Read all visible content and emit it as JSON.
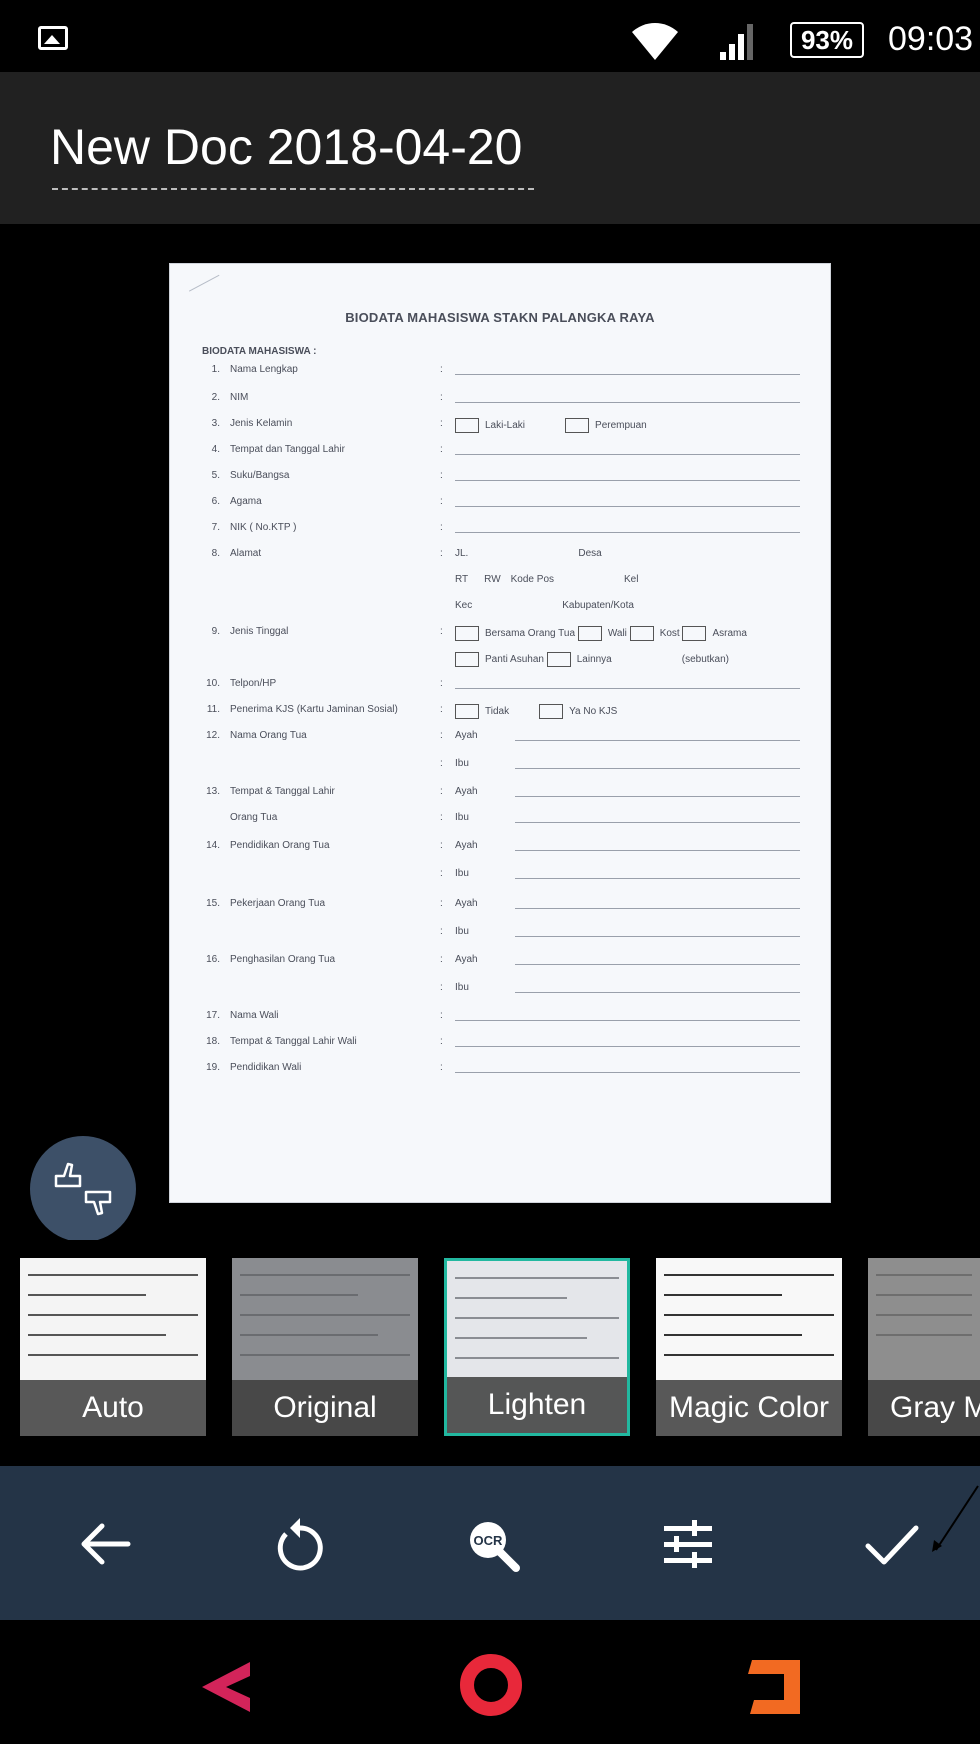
{
  "status_bar": {
    "battery": "93%",
    "time": "09:03",
    "icons": [
      "gallery-icon",
      "wifi-icon",
      "signal-icon",
      "battery-icon"
    ]
  },
  "header": {
    "title": "New Doc 2018-04-20"
  },
  "document": {
    "title": "BIODATA MAHASISWA STAKN PALANGKA RAYA",
    "section": "BIODATA MAHASISWA :",
    "fields": [
      {
        "num": "1.",
        "label": "Nama Lengkap"
      },
      {
        "num": "2.",
        "label": "NIM"
      },
      {
        "num": "3.",
        "label": "Jenis Kelamin"
      },
      {
        "num": "4.",
        "label": "Tempat dan Tanggal Lahir"
      },
      {
        "num": "5.",
        "label": "Suku/Bangsa"
      },
      {
        "num": "6.",
        "label": "Agama"
      },
      {
        "num": "7.",
        "label": "NIK ( No.KTP )"
      },
      {
        "num": "8.",
        "label": "Alamat"
      },
      {
        "num": "9.",
        "label": "Jenis Tinggal"
      },
      {
        "num": "10.",
        "label": "Telpon/HP"
      },
      {
        "num": "11.",
        "label": "Penerima KJS (Kartu Jaminan Sosial)"
      },
      {
        "num": "12.",
        "label": "Nama Orang Tua"
      },
      {
        "num": "13.",
        "label": "Tempat & Tanggal Lahir"
      },
      {
        "num": "",
        "label": "Orang Tua"
      },
      {
        "num": "14.",
        "label": "Pendidikan Orang Tua"
      },
      {
        "num": "15.",
        "label": "Pekerjaan Orang Tua"
      },
      {
        "num": "16.",
        "label": "Penghasilan Orang Tua"
      },
      {
        "num": "17.",
        "label": "Nama Wali"
      },
      {
        "num": "18.",
        "label": "Tempat & Tanggal Lahir Wali"
      },
      {
        "num": "19.",
        "label": "Pendidikan Wali"
      }
    ],
    "gender_options": [
      "Laki-Laki",
      "Perempuan"
    ],
    "address_parts": {
      "line1": "JL.",
      "desa": "Desa",
      "rt": "RT",
      "rw": "RW",
      "kodepos": "Kode Pos",
      "kel": "Kel",
      "kec": "Kec",
      "kab": "Kabupaten/Kota"
    },
    "residence_options": [
      "Bersama Orang Tua",
      "Wali",
      "Kost",
      "Asrama",
      "Panti Asuhan",
      "Lainnya",
      "(sebutkan)"
    ],
    "kjs_options": [
      "Tidak",
      "Ya",
      "No KJS"
    ],
    "parent_labels": {
      "father": "Ayah",
      "mother": "Ibu"
    }
  },
  "filters": [
    {
      "label": "Auto",
      "selected": false
    },
    {
      "label": "Original",
      "selected": false
    },
    {
      "label": "Lighten",
      "selected": true
    },
    {
      "label": "Magic Color",
      "selected": false
    },
    {
      "label": "Gray M",
      "selected": false
    }
  ],
  "actions": [
    "back-arrow-icon",
    "rotate-icon",
    "ocr-icon",
    "adjust-sliders-icon",
    "checkmark-icon"
  ],
  "colors": {
    "accent": "#22b8a0",
    "action_bar": "#243447",
    "fab": "#3d5068",
    "nav_back": "#d3245a",
    "nav_home": "#e8283a",
    "nav_recent": "#f26a22"
  }
}
